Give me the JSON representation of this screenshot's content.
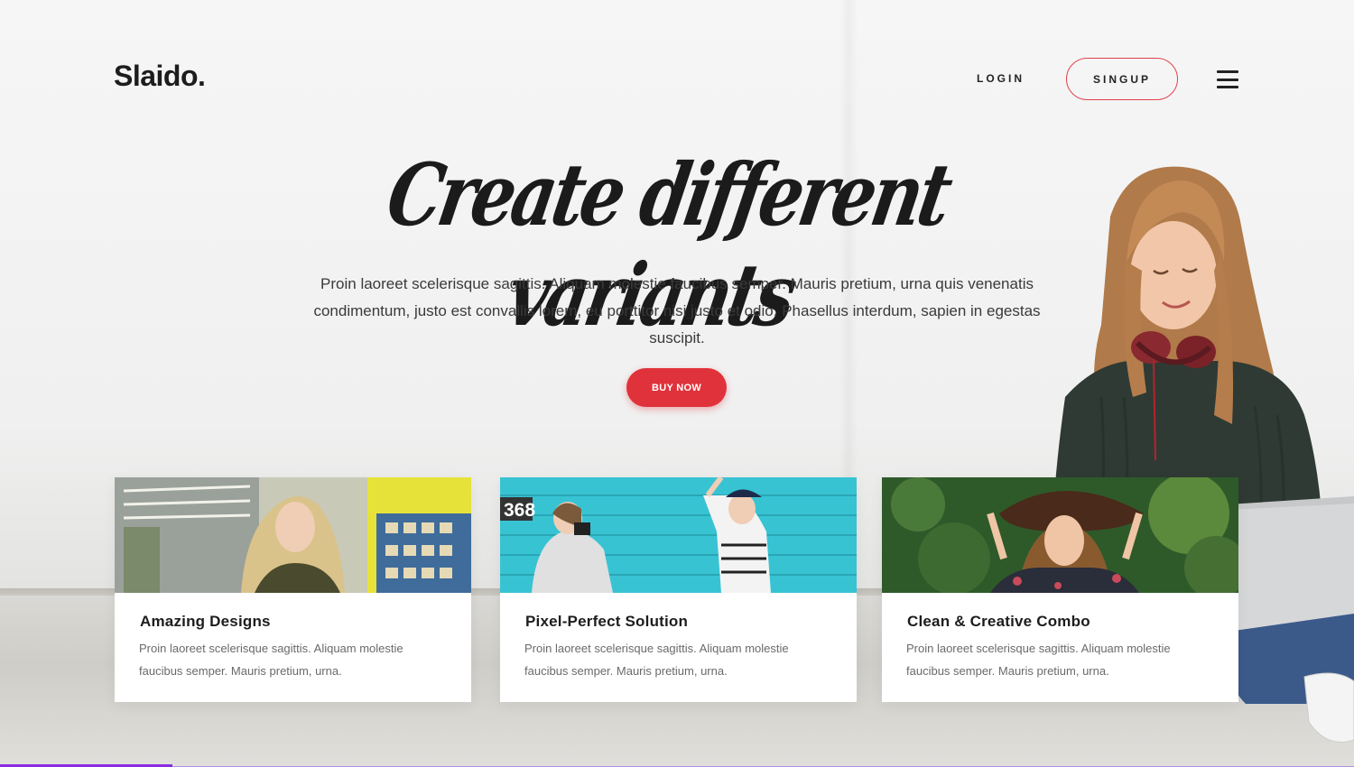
{
  "header": {
    "logo": "Slaido.",
    "login_label": "LOGIN",
    "signup_label": "SINGUP"
  },
  "hero": {
    "title": "Create different variants",
    "text": "Proin laoreet scelerisque sagittis. Aliquam molestie faucibus semper. Mauris pretium, urna quis venenatis condimentum, justo est convallis lorem, eu porttitor nisi justo et odio. Phasellus interdum, sapien in egestas suscipit.",
    "button_label": "BUY NOW"
  },
  "cards": [
    {
      "title": "Amazing Designs",
      "text": "Proin laoreet scelerisque sagittis. Aliquam molestie faucibus semper. Mauris pretium, urna."
    },
    {
      "title": "Pixel-Perfect Solution",
      "text": "Proin laoreet scelerisque sagittis. Aliquam molestie faucibus semper. Mauris pretium, urna.",
      "image_badge": "368"
    },
    {
      "title": "Clean & Creative Combo",
      "text": "Proin laoreet scelerisque sagittis. Aliquam molestie faucibus semper. Mauris pretium, urna."
    }
  ],
  "colors": {
    "accent_red": "#e0323a",
    "signup_border": "#e3414c",
    "progress_purple": "#8a2be2"
  },
  "icons": {
    "menu": "hamburger-menu-icon"
  },
  "slider_progress_fraction": 0.127
}
